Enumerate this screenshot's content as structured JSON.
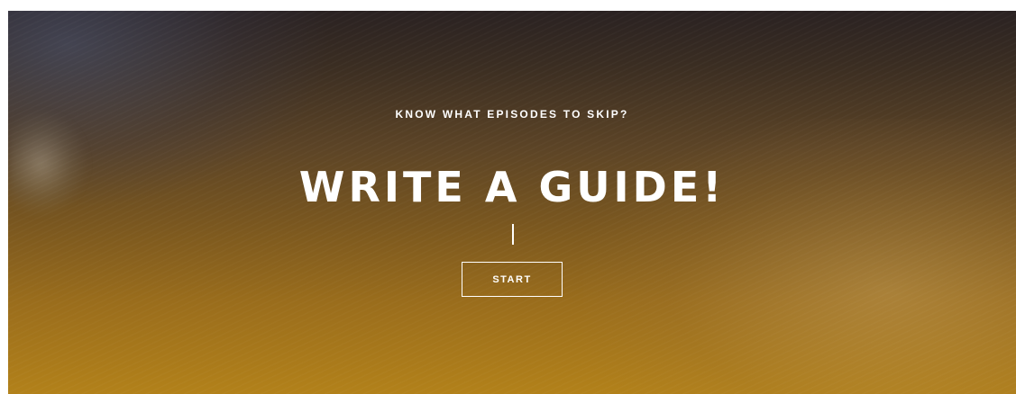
{
  "hero": {
    "eyebrow": "KNOW WHAT EPISODES TO SKIP?",
    "headline": "WRITE A GUIDE!",
    "cta_label": "START"
  },
  "colors": {
    "text": "#ffffff",
    "gradient_top": "#2a2222",
    "gradient_bottom": "#b2811a"
  }
}
